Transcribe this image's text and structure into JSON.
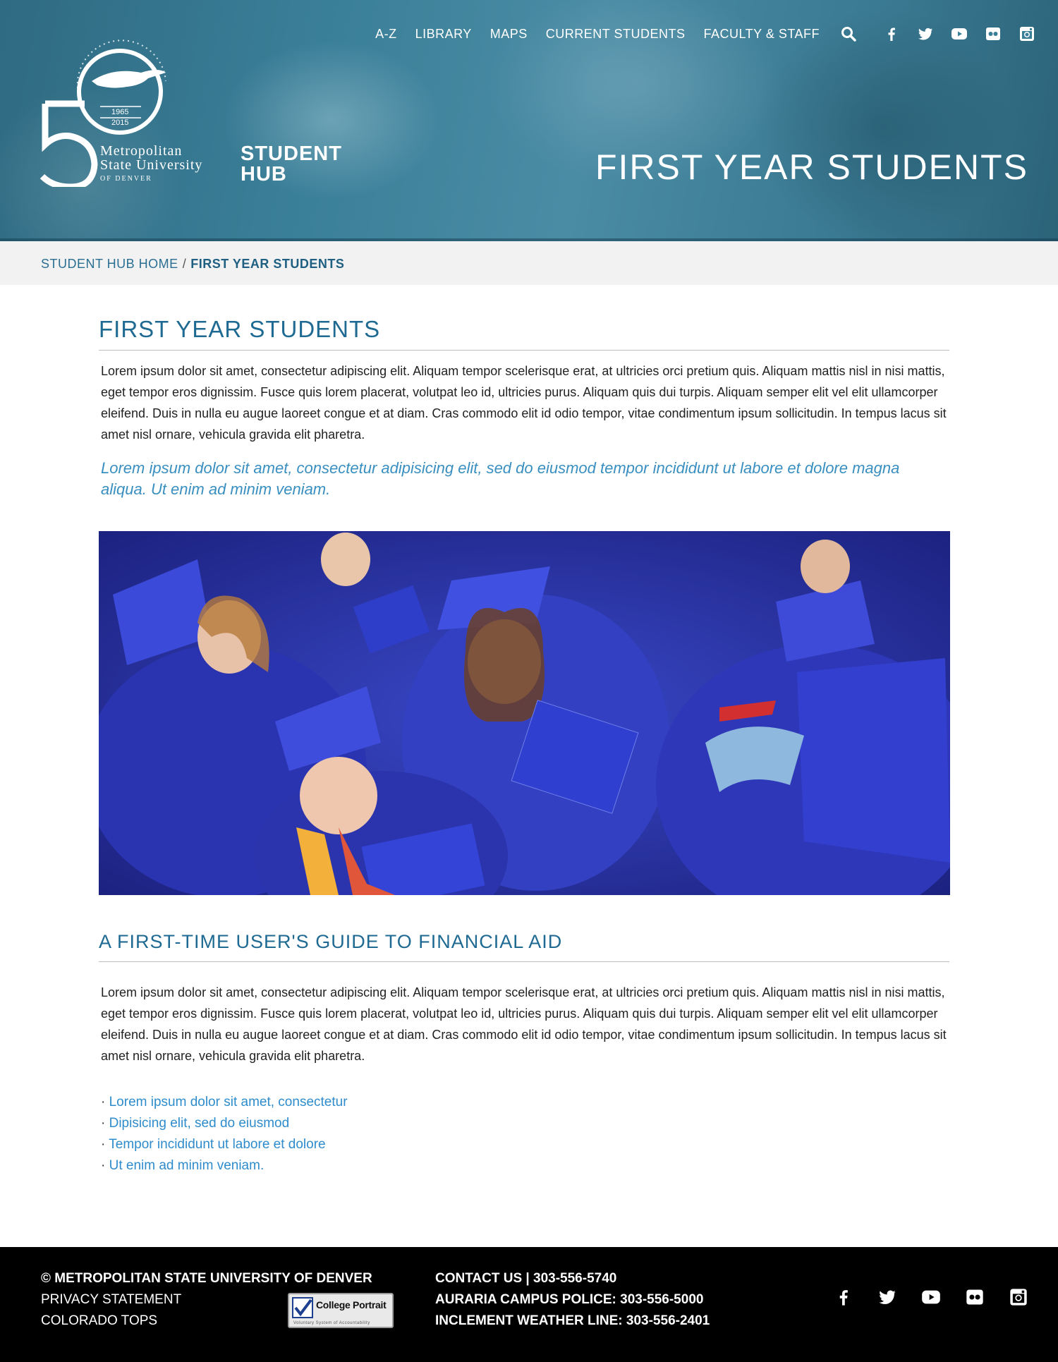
{
  "header": {
    "nav": [
      "A-Z",
      "LIBRARY",
      "MAPS",
      "CURRENT STUDENTS",
      "FACULTY & STAFF"
    ],
    "search_icon": "search-icon",
    "social_icons": [
      "facebook-icon",
      "twitter-icon",
      "youtube-icon",
      "flickr-icon",
      "instagram-icon"
    ],
    "logo": {
      "arc_text": "FIFTY YEARS OF TRANSFORMING LIVES",
      "number": "50",
      "year_start": "1965",
      "year_end": "2015",
      "line1": "Metropolitan",
      "line2": "State University",
      "line3": "OF DENVER"
    },
    "hub_line1": "STUDENT",
    "hub_line2": "HUB",
    "hero_title": "FIRST YEAR STUDENTS",
    "colors": {
      "overlay": "#3a7f98",
      "text": "#ffffff"
    }
  },
  "breadcrumb": {
    "home": "STUDENT HUB HOME",
    "separator": "/",
    "current": "FIRST YEAR STUDENTS"
  },
  "main": {
    "title": "FIRST YEAR STUDENTS",
    "intro": "Lorem ipsum dolor sit amet, consectetur adipiscing elit. Aliquam tempor scelerisque erat, at ultricies orci pretium quis. Aliquam mattis nisl in nisi mattis, eget tempor eros dignissim. Fusce quis lorem placerat, volutpat leo id, ultricies purus. Aliquam quis dui turpis. Aliquam semper elit vel elit ullamcorper eleifend. Duis in nulla eu augue laoreet congue et at diam. Cras commodo elit id odio tempor, vitae condimentum ipsum sollicitudin. In tempus lacus sit amet nisl ornare, vehicula gravida elit pharetra.",
    "lead": "Lorem ipsum dolor sit amet, consectetur adipisicing elit, sed do eiusmod tempor incididunt ut labore et dolore magna aliqua. Ut enim ad minim veniam.",
    "section2_title": "A FIRST-TIME USER'S GUIDE TO FINANCIAL AID",
    "section2_body": "Lorem ipsum dolor sit amet, consectetur adipiscing elit. Aliquam tempor scelerisque erat, at ultricies orci pretium quis. Aliquam mattis nisl in nisi mattis, eget tempor eros dignissim. Fusce quis lorem placerat, volutpat leo id, ultricies purus. Aliquam quis dui turpis. Aliquam semper elit vel elit ullamcorper eleifend. Duis in nulla eu augue laoreet congue et at diam. Cras commodo elit id odio tempor, vitae condimentum ipsum sollicitudin. In tempus lacus sit amet nisl ornare, vehicula gravida elit pharetra.",
    "bullet": "·",
    "links": [
      "Lorem ipsum dolor sit amet, consectetur",
      "Dipisicing elit, sed do eiusmod",
      "Tempor incididunt ut labore et dolore",
      "Ut enim ad minim veniam."
    ],
    "colors": {
      "heading": "#1f6a92",
      "link": "#2f8ccc",
      "lead": "#3a8fc1"
    }
  },
  "footer": {
    "copyright": "© METROPOLITAN STATE UNIVERSITY OF DENVER",
    "privacy": "PRIVACY STATEMENT",
    "tops": "COLORADO TOPS",
    "badge_title": "College Portrait",
    "badge_sub": "Voluntary System of Accountability",
    "contact": "CONTACT US | 303-556-5740",
    "police": "AURARIA CAMPUS POLICE: 303-556-5000",
    "weather": "INCLEMENT WEATHER LINE: 303-556-2401",
    "social_icons": [
      "facebook-icon",
      "twitter-icon",
      "youtube-icon",
      "flickr-icon",
      "instagram-icon"
    ]
  }
}
